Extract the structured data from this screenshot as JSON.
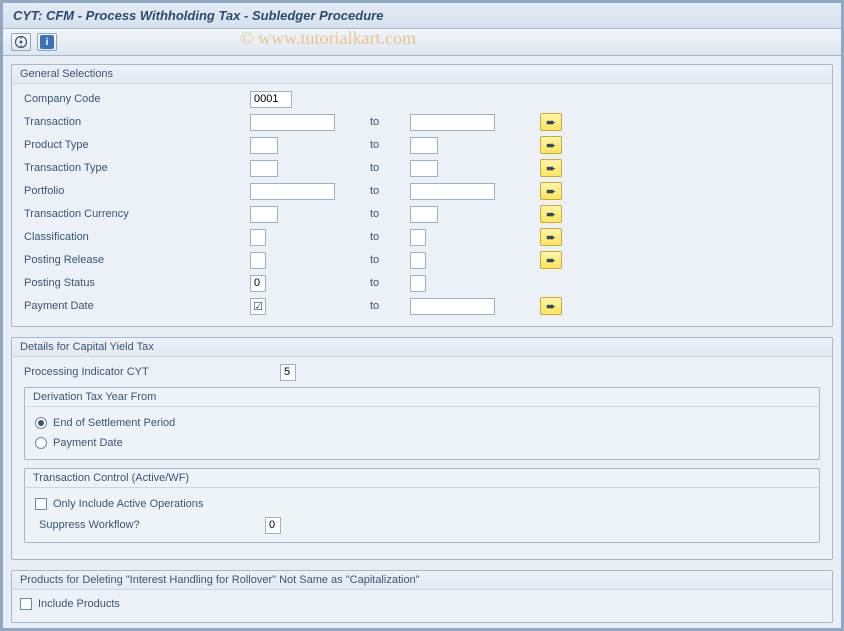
{
  "title": "CYT: CFM - Process Withholding Tax - Subledger Procedure",
  "watermark": "© www.tutorialkart.com",
  "to_label": "to",
  "groups": {
    "general": {
      "title": "General Selections",
      "rows": {
        "company_code": {
          "label": "Company Code",
          "from": "0001"
        },
        "transaction": {
          "label": "Transaction",
          "from": "",
          "to": ""
        },
        "product_type": {
          "label": "Product Type",
          "from": "",
          "to": ""
        },
        "transaction_type": {
          "label": "Transaction Type",
          "from": "",
          "to": ""
        },
        "portfolio": {
          "label": "Portfolio",
          "from": "",
          "to": ""
        },
        "tx_currency": {
          "label": "Transaction Currency",
          "from": "",
          "to": ""
        },
        "classification": {
          "label": "Classification",
          "from": "",
          "to": ""
        },
        "posting_release": {
          "label": "Posting Release",
          "from": "",
          "to": ""
        },
        "posting_status": {
          "label": "Posting Status",
          "from": "0",
          "to": ""
        },
        "payment_date": {
          "label": "Payment Date",
          "from_display": "☑",
          "to": ""
        }
      }
    },
    "details": {
      "title": "Details for Capital Yield Tax",
      "processing_indicator": {
        "label": "Processing Indicator CYT",
        "value": "5"
      },
      "derivation": {
        "title": "Derivation Tax Year From",
        "opt1": "End of Settlement Period",
        "opt2": "Payment Date"
      },
      "control": {
        "title": "Transaction Control (Active/WF)",
        "chk1": "Only Include Active Operations",
        "suppress": {
          "label": "Suppress Workflow?",
          "value": "0"
        }
      }
    },
    "products": {
      "title": "Products for Deleting \"Interest Handling for Rollover\" Not Same as \"Capitalization\"",
      "chk": "Include Products"
    }
  }
}
